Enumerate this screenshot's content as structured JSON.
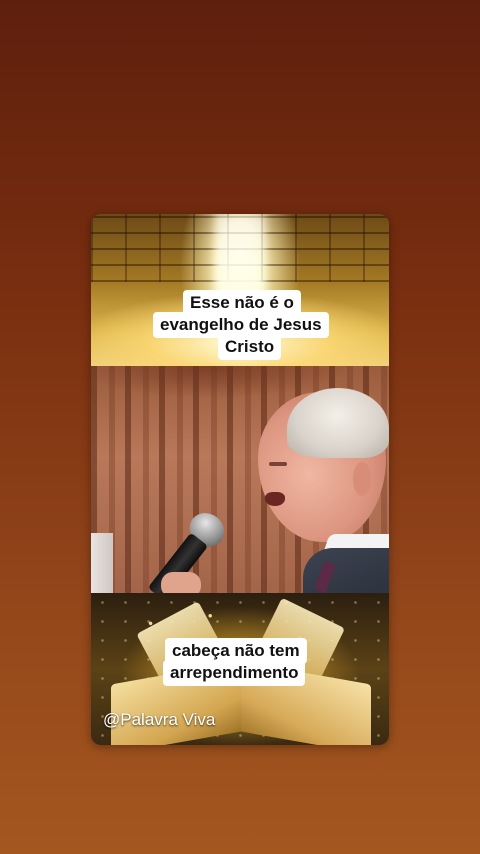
{
  "video": {
    "top_caption_lines": [
      "Esse não é o",
      "evangelho de Jesus",
      "Cristo"
    ],
    "bottom_caption_lines": [
      "cabeça não tem",
      "arrependimento"
    ],
    "watermark": "@Palavra Viva"
  },
  "colors": {
    "background_top": "#5e1f0d",
    "background_bottom": "#a4571f",
    "caption_bg": "#ffffff",
    "caption_text": "#111111"
  }
}
